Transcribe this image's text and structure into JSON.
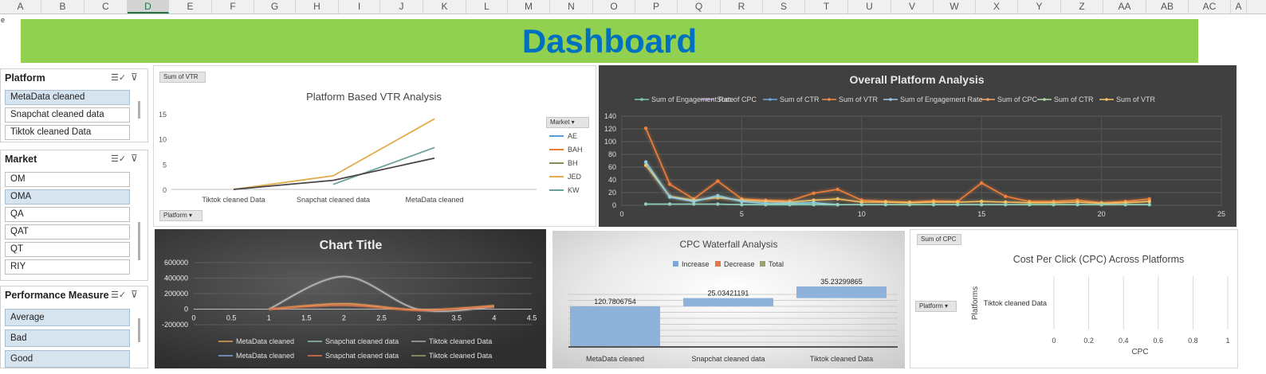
{
  "columns": [
    "A",
    "B",
    "C",
    "D",
    "E",
    "F",
    "G",
    "H",
    "I",
    "J",
    "K",
    "L",
    "M",
    "N",
    "O",
    "P",
    "Q",
    "R",
    "S",
    "T",
    "U",
    "V",
    "W",
    "X",
    "Y",
    "Z",
    "AA",
    "AB",
    "AC",
    "A"
  ],
  "selected_column": "D",
  "cell_fragment": "e",
  "banner": {
    "title": "Dashboard",
    "bg": "#92d050",
    "color": "#0070c0"
  },
  "slicers": {
    "platform": {
      "title": "Platform",
      "items": [
        {
          "label": "MetaData cleaned",
          "selected": true
        },
        {
          "label": "Snapchat cleaned data",
          "selected": false
        },
        {
          "label": "Tiktok cleaned Data",
          "selected": false
        }
      ]
    },
    "market": {
      "title": "Market",
      "items": [
        {
          "label": "OM",
          "selected": false
        },
        {
          "label": "OMA",
          "selected": true
        },
        {
          "label": "QA",
          "selected": false
        },
        {
          "label": "QAT",
          "selected": false
        },
        {
          "label": "QT",
          "selected": false
        },
        {
          "label": "RIY",
          "selected": false
        }
      ]
    },
    "performance": {
      "title": "Performance Measure",
      "items": [
        {
          "label": "Average",
          "selected": true
        },
        {
          "label": "Bad",
          "selected": true
        },
        {
          "label": "Good",
          "selected": true
        }
      ]
    }
  },
  "vtr_chart": {
    "field_button": "Sum of VTR",
    "axis_button": "Platform",
    "legend_button": "Market",
    "chart_data": {
      "type": "line",
      "title": "Platform Based VTR Analysis",
      "categories": [
        "Tiktok cleaned Data",
        "Snapchat cleaned data",
        "MetaData cleaned"
      ],
      "ylim": [
        0,
        15
      ],
      "yticks": [
        0,
        5,
        10,
        15
      ],
      "legend_position": "right",
      "series": [
        {
          "name": "AE",
          "color": "#5b9bd5",
          "values": [
            null,
            null,
            null
          ]
        },
        {
          "name": "BAH",
          "color": "#ed7d31",
          "values": [
            null,
            null,
            null
          ]
        },
        {
          "name": "BH",
          "color": "#7f8f57",
          "values": [
            null,
            null,
            null
          ]
        },
        {
          "name": "JED",
          "color": "#e2ac4c",
          "values": [
            0,
            2.7,
            14
          ]
        },
        {
          "name": "KW",
          "color": "#6aa19a",
          "values": [
            null,
            1.0,
            8.3
          ]
        },
        {
          "name": "",
          "color": "#4a4448",
          "values": [
            0,
            1.8,
            6.2
          ]
        }
      ]
    }
  },
  "overall_chart": {
    "chart_data": {
      "type": "line",
      "title": "Overall Platform Analysis",
      "xlim": [
        0,
        25
      ],
      "xticks": [
        0,
        5,
        10,
        15,
        20,
        25
      ],
      "ylim": [
        0,
        140
      ],
      "yticks": [
        0,
        20,
        40,
        60,
        80,
        100,
        120,
        140
      ],
      "legend_position": "top",
      "legend": [
        {
          "name": "Sum of Engagement Rate",
          "color": "#7ec8b3"
        },
        {
          "name": "Sum of CPC",
          "color": "#b9a6c9"
        },
        {
          "name": "Sum of CTR",
          "color": "#6fa8dc"
        },
        {
          "name": "Sum of VTR",
          "color": "#f08a4b"
        },
        {
          "name": "Sum of Engagement Rate",
          "color": "#9fc5e8"
        },
        {
          "name": "Sum of CPC",
          "color": "#f4a460"
        },
        {
          "name": "Sum of CTR",
          "color": "#b6d7a8"
        },
        {
          "name": "Sum of VTR",
          "color": "#f6c26b"
        }
      ],
      "series": [
        {
          "name": "Sum of CPC",
          "color": "#ef7f3a",
          "x": [
            1,
            2,
            3,
            4,
            5,
            6,
            7,
            8,
            9,
            10,
            11,
            12,
            13,
            14,
            15,
            16,
            17,
            18,
            19,
            20,
            21,
            22
          ],
          "y": [
            121,
            33,
            10,
            38,
            10,
            8,
            7,
            19,
            25,
            8,
            6,
            5,
            7,
            6,
            35,
            14,
            6,
            6,
            8,
            4,
            6,
            10
          ]
        },
        {
          "name": "Sum of VTR",
          "color": "#f5c060",
          "x": [
            1,
            2,
            3,
            4,
            5,
            6,
            7,
            8,
            9,
            10,
            11,
            12,
            13,
            14,
            15,
            16,
            17,
            18,
            19,
            20,
            21,
            22
          ],
          "y": [
            63,
            14,
            8,
            12,
            8,
            6,
            5,
            8,
            10,
            5,
            5,
            4,
            5,
            5,
            6,
            5,
            4,
            4,
            5,
            3,
            4,
            6
          ]
        },
        {
          "name": "Sum of CTR",
          "color": "#8fd0e6",
          "x": [
            1,
            2,
            3,
            4,
            5,
            6,
            7,
            8,
            9
          ],
          "y": [
            68,
            13,
            6,
            15,
            6,
            3,
            3,
            4,
            1
          ]
        },
        {
          "name": "Sum of Engagement Rate",
          "color": "#8ed1b8",
          "x": [
            1,
            2,
            3,
            4,
            5,
            6,
            7,
            8,
            9,
            10,
            11,
            12,
            13,
            14,
            15,
            16,
            17,
            18,
            19,
            20,
            21,
            22
          ],
          "y": [
            2,
            2,
            2,
            2,
            1,
            1,
            1,
            1,
            1,
            1,
            1,
            1,
            1,
            1,
            1,
            1,
            1,
            1,
            1,
            1,
            1,
            1
          ]
        }
      ]
    }
  },
  "curve_chart": {
    "chart_data": {
      "type": "scatter",
      "title": "Chart Title",
      "xlim": [
        0,
        4.5
      ],
      "xticks": [
        0,
        0.5,
        1,
        1.5,
        2,
        2.5,
        3,
        3.5,
        4,
        4.5
      ],
      "ylim": [
        -200000,
        600000
      ],
      "yticks": [
        -200000,
        0,
        200000,
        400000,
        600000
      ],
      "legend_position": "bottom",
      "legend": [
        {
          "name": "MetaData cleaned",
          "color": "#e3a05a"
        },
        {
          "name": "Snapchat cleaned data",
          "color": "#8cc3b0"
        },
        {
          "name": "Tiktok cleaned Data",
          "color": "#a7a7a7"
        },
        {
          "name": "MetaData cleaned",
          "color": "#7ea6d6"
        },
        {
          "name": "Snapchat cleaned data",
          "color": "#e3784a"
        },
        {
          "name": "Tiktok cleaned Data",
          "color": "#9aa36d"
        }
      ],
      "series": [
        {
          "name": "Tiktok cleaned Data",
          "color": "#b9b9b9",
          "x": [
            1,
            2,
            3,
            4
          ],
          "y": [
            0,
            420000,
            -5000,
            30000
          ]
        },
        {
          "name": "MetaData cleaned",
          "color": "#e3a05a",
          "x": [
            1,
            2,
            3,
            4
          ],
          "y": [
            0,
            70000,
            -10000,
            45000
          ]
        },
        {
          "name": "Snapchat cleaned data",
          "color": "#e3784a",
          "x": [
            1,
            2,
            3,
            4
          ],
          "y": [
            0,
            50000,
            -15000,
            35000
          ]
        }
      ]
    }
  },
  "waterfall_chart": {
    "chart_data": {
      "type": "bar",
      "title": "CPC Waterfall Analysis",
      "legend": [
        {
          "name": "Increase",
          "color": "#7ea6d6"
        },
        {
          "name": "Decrease",
          "color": "#e3784a"
        },
        {
          "name": "Total",
          "color": "#9aa36d"
        }
      ],
      "legend_position": "top",
      "categories": [
        "MetaData cleaned",
        "Snapchat cleaned data",
        "Tiktok cleaned Data"
      ],
      "values": [
        120.7806754,
        25.03421191,
        35.23299865
      ],
      "labels": [
        "120.7806754",
        "25.03421191",
        "35.23299865"
      ]
    }
  },
  "cpc_chart": {
    "field_button": "Sum of CPC",
    "axis_button": "Platform",
    "chart_data": {
      "type": "bar",
      "title": "Cost Per Click (CPC) Across Platforms",
      "categories": [
        "Tiktok cleaned Data"
      ],
      "values": [
        null
      ],
      "xlabel": "CPC",
      "ylabel": "Platforms",
      "xlim": [
        0,
        1
      ],
      "xticks": [
        "0",
        "0.2",
        "0.4",
        "0.6",
        "0.8",
        "1"
      ]
    }
  }
}
